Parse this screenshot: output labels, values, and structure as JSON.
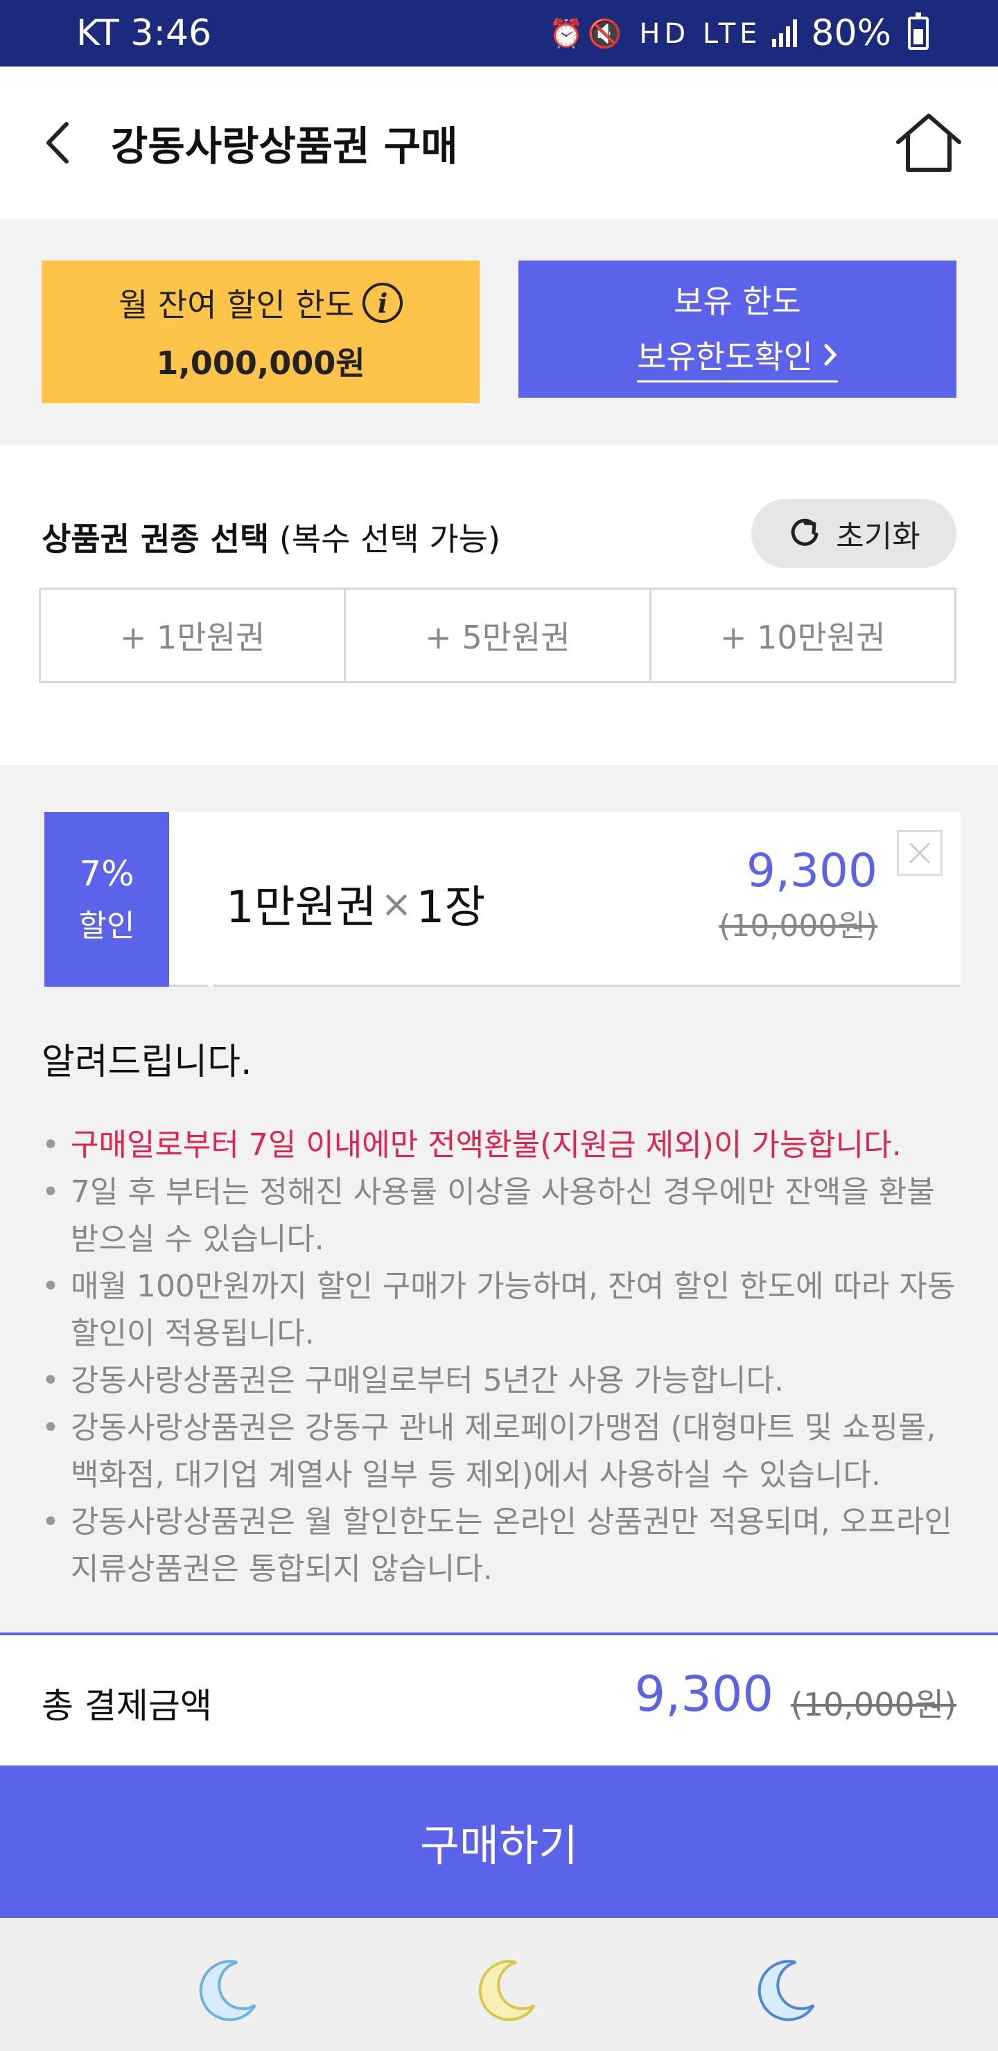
{
  "status_bar": {
    "carrier_time": "KT 3:46",
    "icons": "⏰🔇 HD LTE",
    "battery": "80%"
  },
  "header": {
    "title": "강동사랑상품권 구매"
  },
  "limits": {
    "monthly_label": "월 잔여 할인 한도",
    "monthly_value": "1,000,000원",
    "holding_label": "보유 한도",
    "holding_link": "보유한도확인"
  },
  "selection": {
    "title_bold": "상품권 권종 선택",
    "title_note": "(복수 선택 가능)",
    "reset_label": "초기화",
    "options": [
      "+ 1만원권",
      "+ 5만원권",
      "+ 10만원권"
    ]
  },
  "ticket": {
    "discount": "7%",
    "discount_label": "할인",
    "name": "1만원권",
    "times": "×",
    "quantity": "1장",
    "price": "9,300",
    "original": "(10,000원)"
  },
  "notice": {
    "title": "알려드립니다.",
    "items": [
      "구매일로부터 7일 이내에만 전액환불(지원금 제외)이 가능합니다.",
      "7일 후 부터는 정해진 사용률 이상을 사용하신 경우에만 잔액을 환불 받으실 수 있습니다.",
      "매월 100만원까지 할인 구매가 가능하며, 잔여 할인 한도에 따라 자동 할인이 적용됩니다.",
      "강동사랑상품권은 구매일로부터 5년간 사용 가능합니다.",
      "강동사랑상품권은 강동구 관내 제로페이가맹점 (대형마트 및 쇼핑몰, 백화점, 대기업 계열사 일부 등 제외)에서 사용하실 수 있습니다.",
      "강동사랑상품권은 월 할인한도는 온라인 상품권만 적용되며, 오프라인 지류상품권은 통합되지 않습니다."
    ]
  },
  "total": {
    "label": "총 결제금액",
    "price": "9,300",
    "original": "(10,000원)"
  },
  "buy_button": "구매하기",
  "colors": {
    "status_bar": "#1c2a7e",
    "accent": "#5b63ea",
    "limit_yellow": "#fec44a",
    "notice_red": "#e0234f"
  },
  "icons": {
    "back": "chevron-left-icon",
    "home": "home-icon",
    "info": "info-icon",
    "reset": "refresh-icon",
    "close": "close-icon",
    "link": "chevron-right-icon",
    "bottom": [
      "moon-icon-blue",
      "moon-icon-yellow",
      "moon-icon-blue"
    ]
  }
}
